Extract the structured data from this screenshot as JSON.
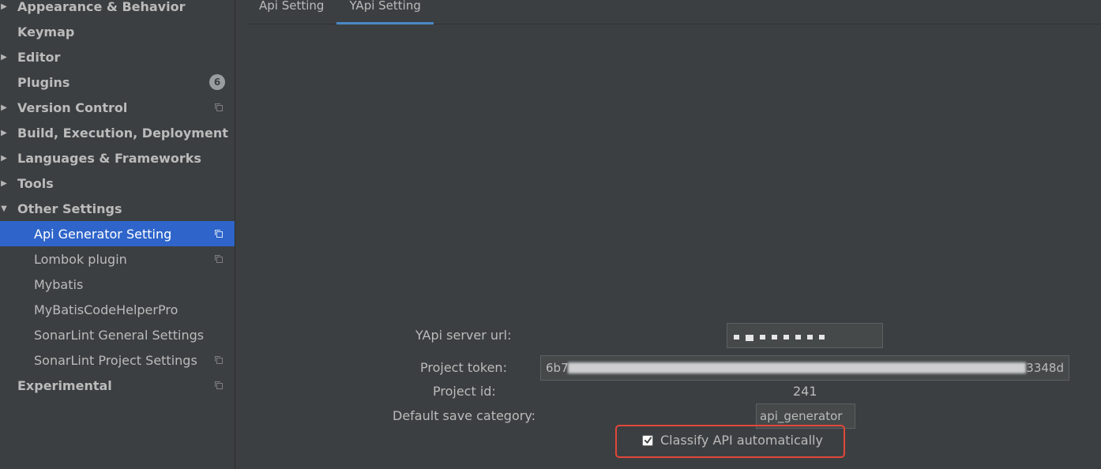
{
  "sidebar": {
    "items": [
      {
        "label": "Appearance & Behavior",
        "bold": true,
        "arrow": "▶",
        "indent": 0
      },
      {
        "label": "Keymap",
        "bold": true,
        "arrow": "",
        "indent": 0
      },
      {
        "label": "Editor",
        "bold": true,
        "arrow": "▶",
        "indent": 0
      },
      {
        "label": "Plugins",
        "bold": true,
        "arrow": "",
        "indent": 0,
        "badge": "6"
      },
      {
        "label": "Version Control",
        "bold": true,
        "arrow": "▶",
        "indent": 0,
        "projectIcon": true
      },
      {
        "label": "Build, Execution, Deployment",
        "bold": true,
        "arrow": "▶",
        "indent": 0
      },
      {
        "label": "Languages & Frameworks",
        "bold": true,
        "arrow": "▶",
        "indent": 0
      },
      {
        "label": "Tools",
        "bold": true,
        "arrow": "▶",
        "indent": 0
      },
      {
        "label": "Other Settings",
        "bold": true,
        "arrow": "▼",
        "indent": 0
      },
      {
        "label": "Api Generator Setting",
        "bold": false,
        "arrow": "",
        "indent": 1,
        "projectIcon": true,
        "selected": true
      },
      {
        "label": "Lombok plugin",
        "bold": false,
        "arrow": "",
        "indent": 1,
        "projectIcon": true
      },
      {
        "label": "Mybatis",
        "bold": false,
        "arrow": "",
        "indent": 1
      },
      {
        "label": "MyBatisCodeHelperPro",
        "bold": false,
        "arrow": "",
        "indent": 1
      },
      {
        "label": "SonarLint General Settings",
        "bold": false,
        "arrow": "",
        "indent": 1
      },
      {
        "label": "SonarLint Project Settings",
        "bold": false,
        "arrow": "",
        "indent": 1,
        "projectIcon": true
      },
      {
        "label": "Experimental",
        "bold": true,
        "arrow": "",
        "indent": 0,
        "projectIcon": true
      }
    ]
  },
  "tabs": [
    {
      "label": "Api Setting",
      "active": false
    },
    {
      "label": "YApi Setting",
      "active": true
    }
  ],
  "form": {
    "server_url_label": "YApi server url:",
    "token_label": "Project token:",
    "token_value_start": "6b7",
    "token_value_end": "3348d",
    "project_id_label": "Project id:",
    "project_id_value": "241",
    "category_label": "Default save category:",
    "category_value": "api_generator",
    "classify_label": "Classify API automatically",
    "classify_checked": true
  },
  "colors": {
    "selection": "#2f65ca",
    "tab_underline": "#4a88c7",
    "highlight_box": "#e2473b"
  },
  "icons": {
    "tree_arrow_collapsed": "▶",
    "tree_arrow_expanded": "▼",
    "project_icon": "copy-icon",
    "checkbox_mark": "checkmark-icon"
  }
}
